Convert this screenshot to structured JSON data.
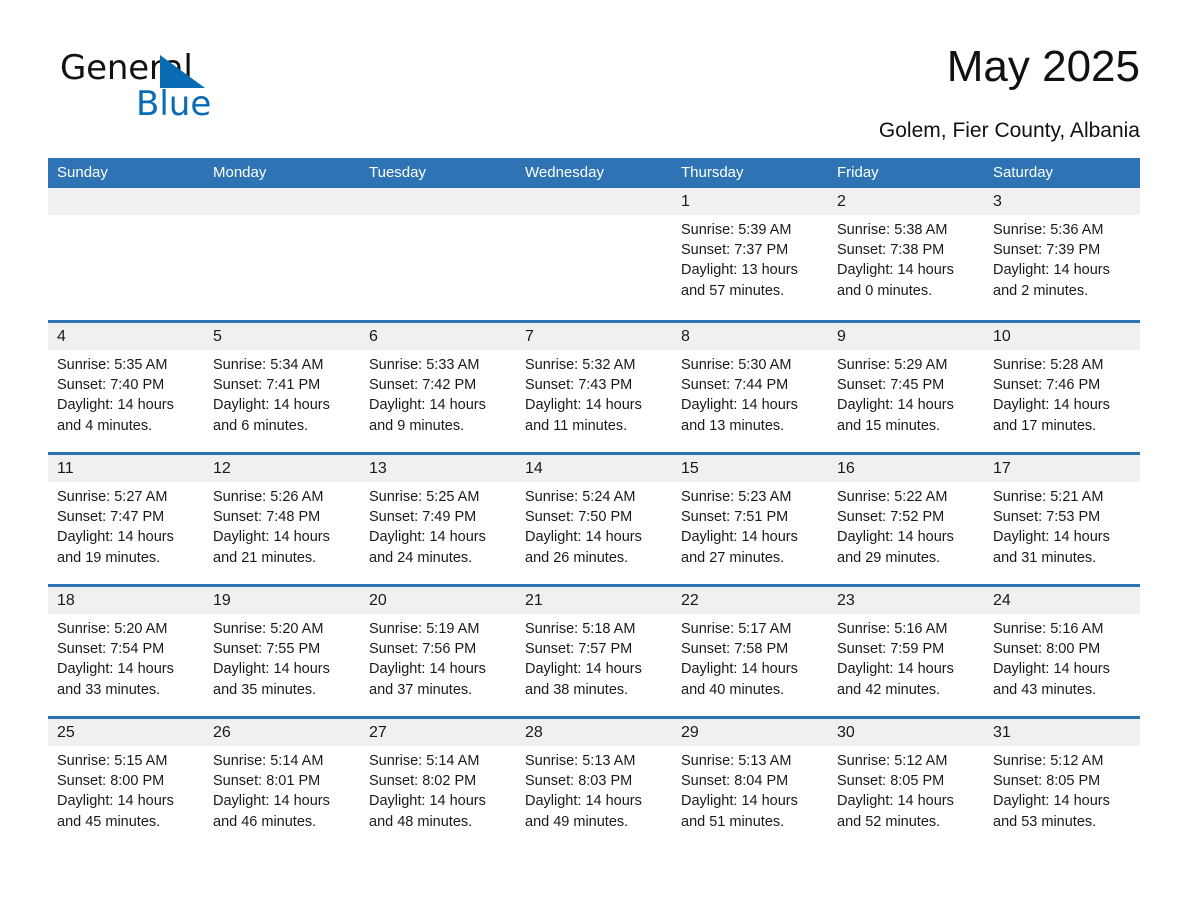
{
  "brand": {
    "name_part1": "General",
    "name_part2": "Blue",
    "triangle_color": "#0a6bb5"
  },
  "header": {
    "title": "May 2025",
    "subtitle": "Golem, Fier County, Albania"
  },
  "theme": {
    "header_blue": "#2e74b5",
    "day_band_gray": "#f0f0f0",
    "text": "#1a1a1a"
  },
  "weekdays": [
    "Sunday",
    "Monday",
    "Tuesday",
    "Wednesday",
    "Thursday",
    "Friday",
    "Saturday"
  ],
  "weeks": [
    [
      {
        "day": "",
        "empty": true
      },
      {
        "day": "",
        "empty": true
      },
      {
        "day": "",
        "empty": true
      },
      {
        "day": "",
        "empty": true
      },
      {
        "day": "1",
        "sunrise": "Sunrise: 5:39 AM",
        "sunset": "Sunset: 7:37 PM",
        "daylight": "Daylight: 13 hours and 57 minutes."
      },
      {
        "day": "2",
        "sunrise": "Sunrise: 5:38 AM",
        "sunset": "Sunset: 7:38 PM",
        "daylight": "Daylight: 14 hours and 0 minutes."
      },
      {
        "day": "3",
        "sunrise": "Sunrise: 5:36 AM",
        "sunset": "Sunset: 7:39 PM",
        "daylight": "Daylight: 14 hours and 2 minutes."
      }
    ],
    [
      {
        "day": "4",
        "sunrise": "Sunrise: 5:35 AM",
        "sunset": "Sunset: 7:40 PM",
        "daylight": "Daylight: 14 hours and 4 minutes."
      },
      {
        "day": "5",
        "sunrise": "Sunrise: 5:34 AM",
        "sunset": "Sunset: 7:41 PM",
        "daylight": "Daylight: 14 hours and 6 minutes."
      },
      {
        "day": "6",
        "sunrise": "Sunrise: 5:33 AM",
        "sunset": "Sunset: 7:42 PM",
        "daylight": "Daylight: 14 hours and 9 minutes."
      },
      {
        "day": "7",
        "sunrise": "Sunrise: 5:32 AM",
        "sunset": "Sunset: 7:43 PM",
        "daylight": "Daylight: 14 hours and 11 minutes."
      },
      {
        "day": "8",
        "sunrise": "Sunrise: 5:30 AM",
        "sunset": "Sunset: 7:44 PM",
        "daylight": "Daylight: 14 hours and 13 minutes."
      },
      {
        "day": "9",
        "sunrise": "Sunrise: 5:29 AM",
        "sunset": "Sunset: 7:45 PM",
        "daylight": "Daylight: 14 hours and 15 minutes."
      },
      {
        "day": "10",
        "sunrise": "Sunrise: 5:28 AM",
        "sunset": "Sunset: 7:46 PM",
        "daylight": "Daylight: 14 hours and 17 minutes."
      }
    ],
    [
      {
        "day": "11",
        "sunrise": "Sunrise: 5:27 AM",
        "sunset": "Sunset: 7:47 PM",
        "daylight": "Daylight: 14 hours and 19 minutes."
      },
      {
        "day": "12",
        "sunrise": "Sunrise: 5:26 AM",
        "sunset": "Sunset: 7:48 PM",
        "daylight": "Daylight: 14 hours and 21 minutes."
      },
      {
        "day": "13",
        "sunrise": "Sunrise: 5:25 AM",
        "sunset": "Sunset: 7:49 PM",
        "daylight": "Daylight: 14 hours and 24 minutes."
      },
      {
        "day": "14",
        "sunrise": "Sunrise: 5:24 AM",
        "sunset": "Sunset: 7:50 PM",
        "daylight": "Daylight: 14 hours and 26 minutes."
      },
      {
        "day": "15",
        "sunrise": "Sunrise: 5:23 AM",
        "sunset": "Sunset: 7:51 PM",
        "daylight": "Daylight: 14 hours and 27 minutes."
      },
      {
        "day": "16",
        "sunrise": "Sunrise: 5:22 AM",
        "sunset": "Sunset: 7:52 PM",
        "daylight": "Daylight: 14 hours and 29 minutes."
      },
      {
        "day": "17",
        "sunrise": "Sunrise: 5:21 AM",
        "sunset": "Sunset: 7:53 PM",
        "daylight": "Daylight: 14 hours and 31 minutes."
      }
    ],
    [
      {
        "day": "18",
        "sunrise": "Sunrise: 5:20 AM",
        "sunset": "Sunset: 7:54 PM",
        "daylight": "Daylight: 14 hours and 33 minutes."
      },
      {
        "day": "19",
        "sunrise": "Sunrise: 5:20 AM",
        "sunset": "Sunset: 7:55 PM",
        "daylight": "Daylight: 14 hours and 35 minutes."
      },
      {
        "day": "20",
        "sunrise": "Sunrise: 5:19 AM",
        "sunset": "Sunset: 7:56 PM",
        "daylight": "Daylight: 14 hours and 37 minutes."
      },
      {
        "day": "21",
        "sunrise": "Sunrise: 5:18 AM",
        "sunset": "Sunset: 7:57 PM",
        "daylight": "Daylight: 14 hours and 38 minutes."
      },
      {
        "day": "22",
        "sunrise": "Sunrise: 5:17 AM",
        "sunset": "Sunset: 7:58 PM",
        "daylight": "Daylight: 14 hours and 40 minutes."
      },
      {
        "day": "23",
        "sunrise": "Sunrise: 5:16 AM",
        "sunset": "Sunset: 7:59 PM",
        "daylight": "Daylight: 14 hours and 42 minutes."
      },
      {
        "day": "24",
        "sunrise": "Sunrise: 5:16 AM",
        "sunset": "Sunset: 8:00 PM",
        "daylight": "Daylight: 14 hours and 43 minutes."
      }
    ],
    [
      {
        "day": "25",
        "sunrise": "Sunrise: 5:15 AM",
        "sunset": "Sunset: 8:00 PM",
        "daylight": "Daylight: 14 hours and 45 minutes."
      },
      {
        "day": "26",
        "sunrise": "Sunrise: 5:14 AM",
        "sunset": "Sunset: 8:01 PM",
        "daylight": "Daylight: 14 hours and 46 minutes."
      },
      {
        "day": "27",
        "sunrise": "Sunrise: 5:14 AM",
        "sunset": "Sunset: 8:02 PM",
        "daylight": "Daylight: 14 hours and 48 minutes."
      },
      {
        "day": "28",
        "sunrise": "Sunrise: 5:13 AM",
        "sunset": "Sunset: 8:03 PM",
        "daylight": "Daylight: 14 hours and 49 minutes."
      },
      {
        "day": "29",
        "sunrise": "Sunrise: 5:13 AM",
        "sunset": "Sunset: 8:04 PM",
        "daylight": "Daylight: 14 hours and 51 minutes."
      },
      {
        "day": "30",
        "sunrise": "Sunrise: 5:12 AM",
        "sunset": "Sunset: 8:05 PM",
        "daylight": "Daylight: 14 hours and 52 minutes."
      },
      {
        "day": "31",
        "sunrise": "Sunrise: 5:12 AM",
        "sunset": "Sunset: 8:05 PM",
        "daylight": "Daylight: 14 hours and 53 minutes."
      }
    ]
  ]
}
